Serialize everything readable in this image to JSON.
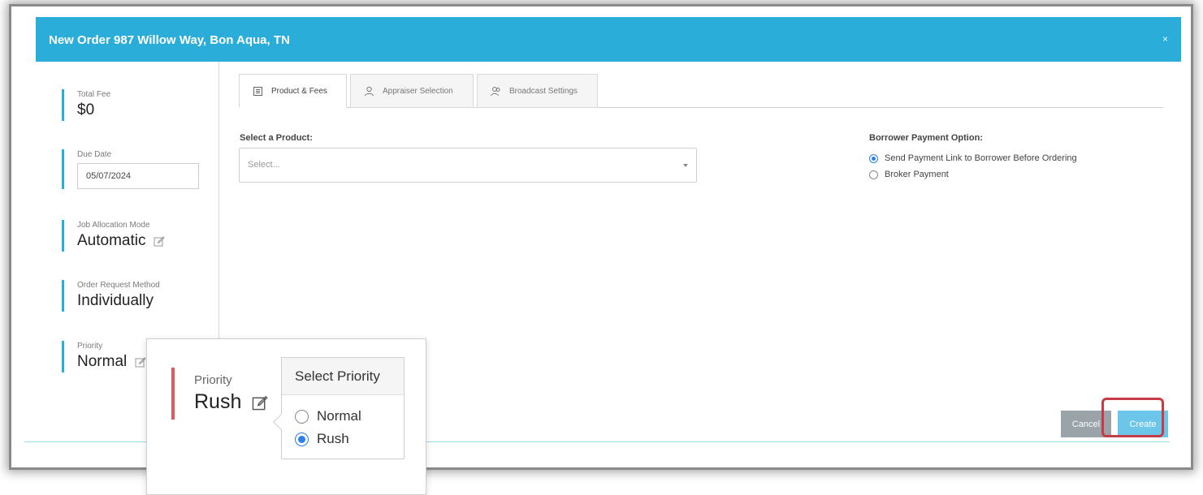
{
  "header": {
    "title": "New Order 987 Willow Way, Bon Aqua, TN",
    "close_label": "×"
  },
  "sidebar": {
    "total_fee": {
      "label": "Total Fee",
      "value": "$0"
    },
    "due_date": {
      "label": "Due Date",
      "value": "05/07/2024"
    },
    "job_allocation": {
      "label": "Job Allocation Mode",
      "value": "Automatic"
    },
    "order_request": {
      "label": "Order Request Method",
      "value": "Individually"
    },
    "priority": {
      "label": "Priority",
      "value": "Normal"
    }
  },
  "tabs": [
    {
      "label": "Product & Fees",
      "icon": "document-icon"
    },
    {
      "label": "Appraiser Selection",
      "icon": "person-icon"
    },
    {
      "label": "Broadcast Settings",
      "icon": "people-icon"
    }
  ],
  "product": {
    "label": "Select a Product:",
    "placeholder": "Select..."
  },
  "payment": {
    "title": "Borrower Payment Option:",
    "options": [
      {
        "label": "Send Payment Link to Borrower Before Ordering",
        "checked": true
      },
      {
        "label": "Broker Payment",
        "checked": false
      }
    ]
  },
  "buttons": {
    "cancel": "Cancel",
    "create": "Create"
  },
  "callout": {
    "priority_label": "Priority",
    "priority_value": "Rush",
    "popover_title": "Select Priority",
    "options": [
      {
        "label": "Normal",
        "checked": false
      },
      {
        "label": "Rush",
        "checked": true
      }
    ]
  },
  "colors": {
    "accent": "#2aaed9",
    "highlight": "#c63c45",
    "rush_bar": "#e05a5f"
  }
}
